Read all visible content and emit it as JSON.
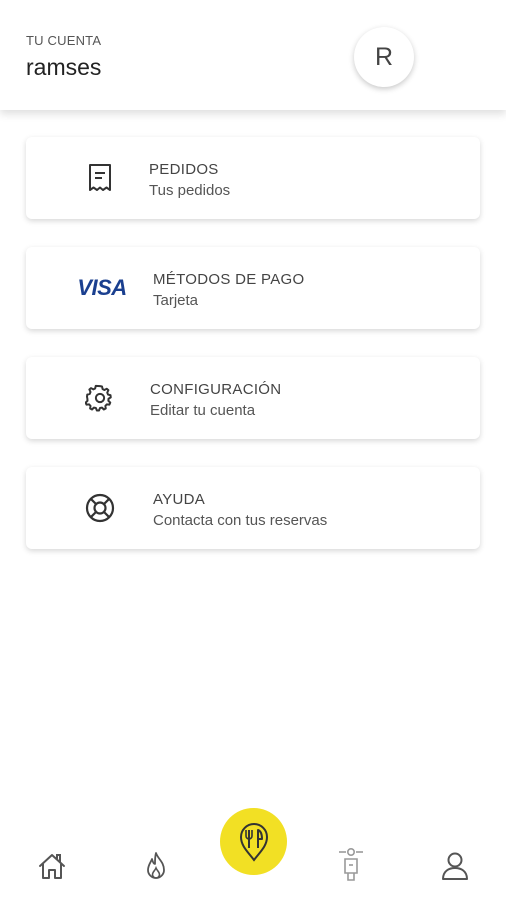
{
  "header": {
    "label": "TU CUENTA",
    "username": "ramses",
    "avatar_letter": "R"
  },
  "menu": [
    {
      "title": "PEDIDOS",
      "subtitle": "Tus pedidos",
      "icon": "receipt-icon"
    },
    {
      "title": "MÉTODOS DE PAGO",
      "subtitle": "Tarjeta",
      "icon": "visa-logo",
      "logo_text": "VISA"
    },
    {
      "title": "CONFIGURACIÓN",
      "subtitle": "Editar tu cuenta",
      "icon": "gear-icon"
    },
    {
      "title": "AYUDA",
      "subtitle": "Contacta con tus reservas",
      "icon": "lifebuoy-icon"
    }
  ],
  "bottom_nav": {
    "items": [
      "home-icon",
      "flame-icon",
      "restaurant-pin-icon",
      "delivery-icon",
      "user-icon"
    ],
    "accent_color": "#f2e024"
  }
}
